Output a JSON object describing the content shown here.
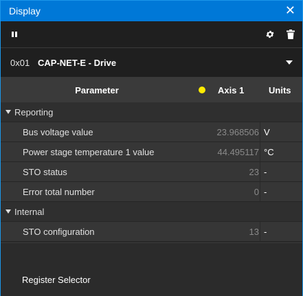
{
  "window": {
    "title": "Display",
    "close_glyph": "✕"
  },
  "toolbar": {
    "left_icons": [
      "pause-icon"
    ],
    "right_icons": [
      "gear-icon",
      "trash-icon"
    ]
  },
  "device": {
    "address": "0x01",
    "name": "CAP-NET-E - Drive"
  },
  "table": {
    "headers": {
      "parameter": "Parameter",
      "axis": "Axis 1",
      "units": "Units"
    },
    "axis_dot_color": "#ffeb00",
    "groups": [
      {
        "label": "Reporting",
        "rows": [
          {
            "name": "Bus voltage value",
            "value": "23.968506",
            "unit": "V"
          },
          {
            "name": "Power stage temperature 1 value",
            "value": "44.495117",
            "unit": "°C"
          },
          {
            "name": "STO status",
            "value": "23",
            "unit": "-"
          },
          {
            "name": "Error total number",
            "value": "0",
            "unit": "-"
          }
        ]
      },
      {
        "label": "Internal",
        "rows": [
          {
            "name": "STO configuration",
            "value": "13",
            "unit": "-"
          }
        ]
      }
    ]
  },
  "footer": {
    "register_selector": "Register Selector"
  },
  "colors": {
    "titlebar": "#0078d7",
    "background": "#2b2b2b"
  }
}
